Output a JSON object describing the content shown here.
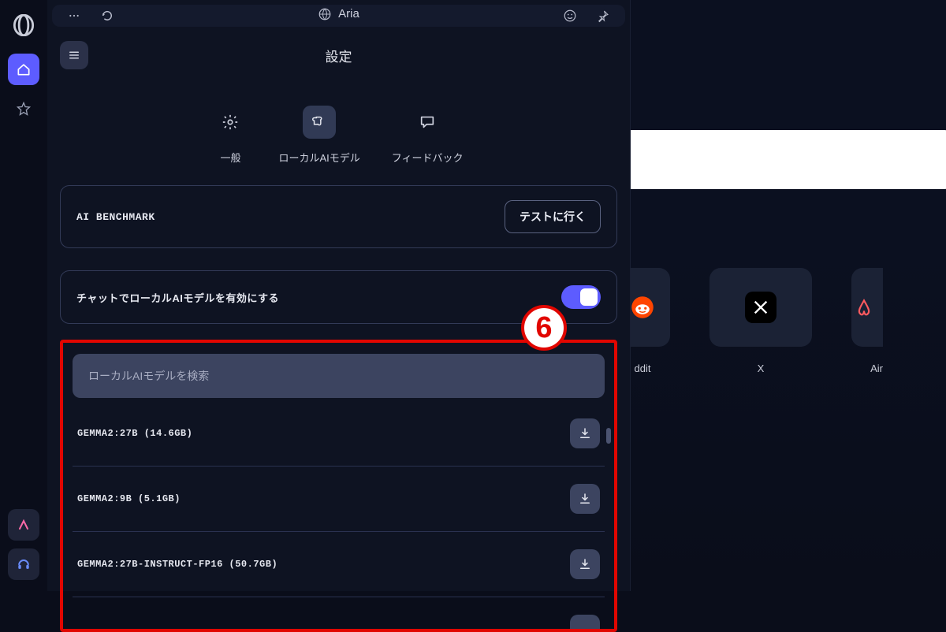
{
  "titlebar": {
    "app_name": "Aria"
  },
  "header": {
    "title": "設定"
  },
  "tabs": {
    "general": "一般",
    "local_ai": "ローカルAIモデル",
    "feedback": "フィードバック"
  },
  "benchmark": {
    "label": "AI BENCHMARK",
    "button": "テストに行く"
  },
  "enable_local": {
    "label": "チャットでローカルAIモデルを有効にする",
    "enabled": true
  },
  "callout": "6",
  "search": {
    "placeholder": "ローカルAIモデルを検索"
  },
  "models": [
    {
      "name": "GEMMA2:27B (14.6GB)"
    },
    {
      "name": "GEMMA2:9B (5.1GB)"
    },
    {
      "name": "GEMMA2:27B-INSTRUCT-FP16 (50.7GB)"
    }
  ],
  "speed_dial": {
    "items": [
      {
        "label": "ddit"
      },
      {
        "label": "X"
      },
      {
        "label": "Air"
      }
    ]
  }
}
